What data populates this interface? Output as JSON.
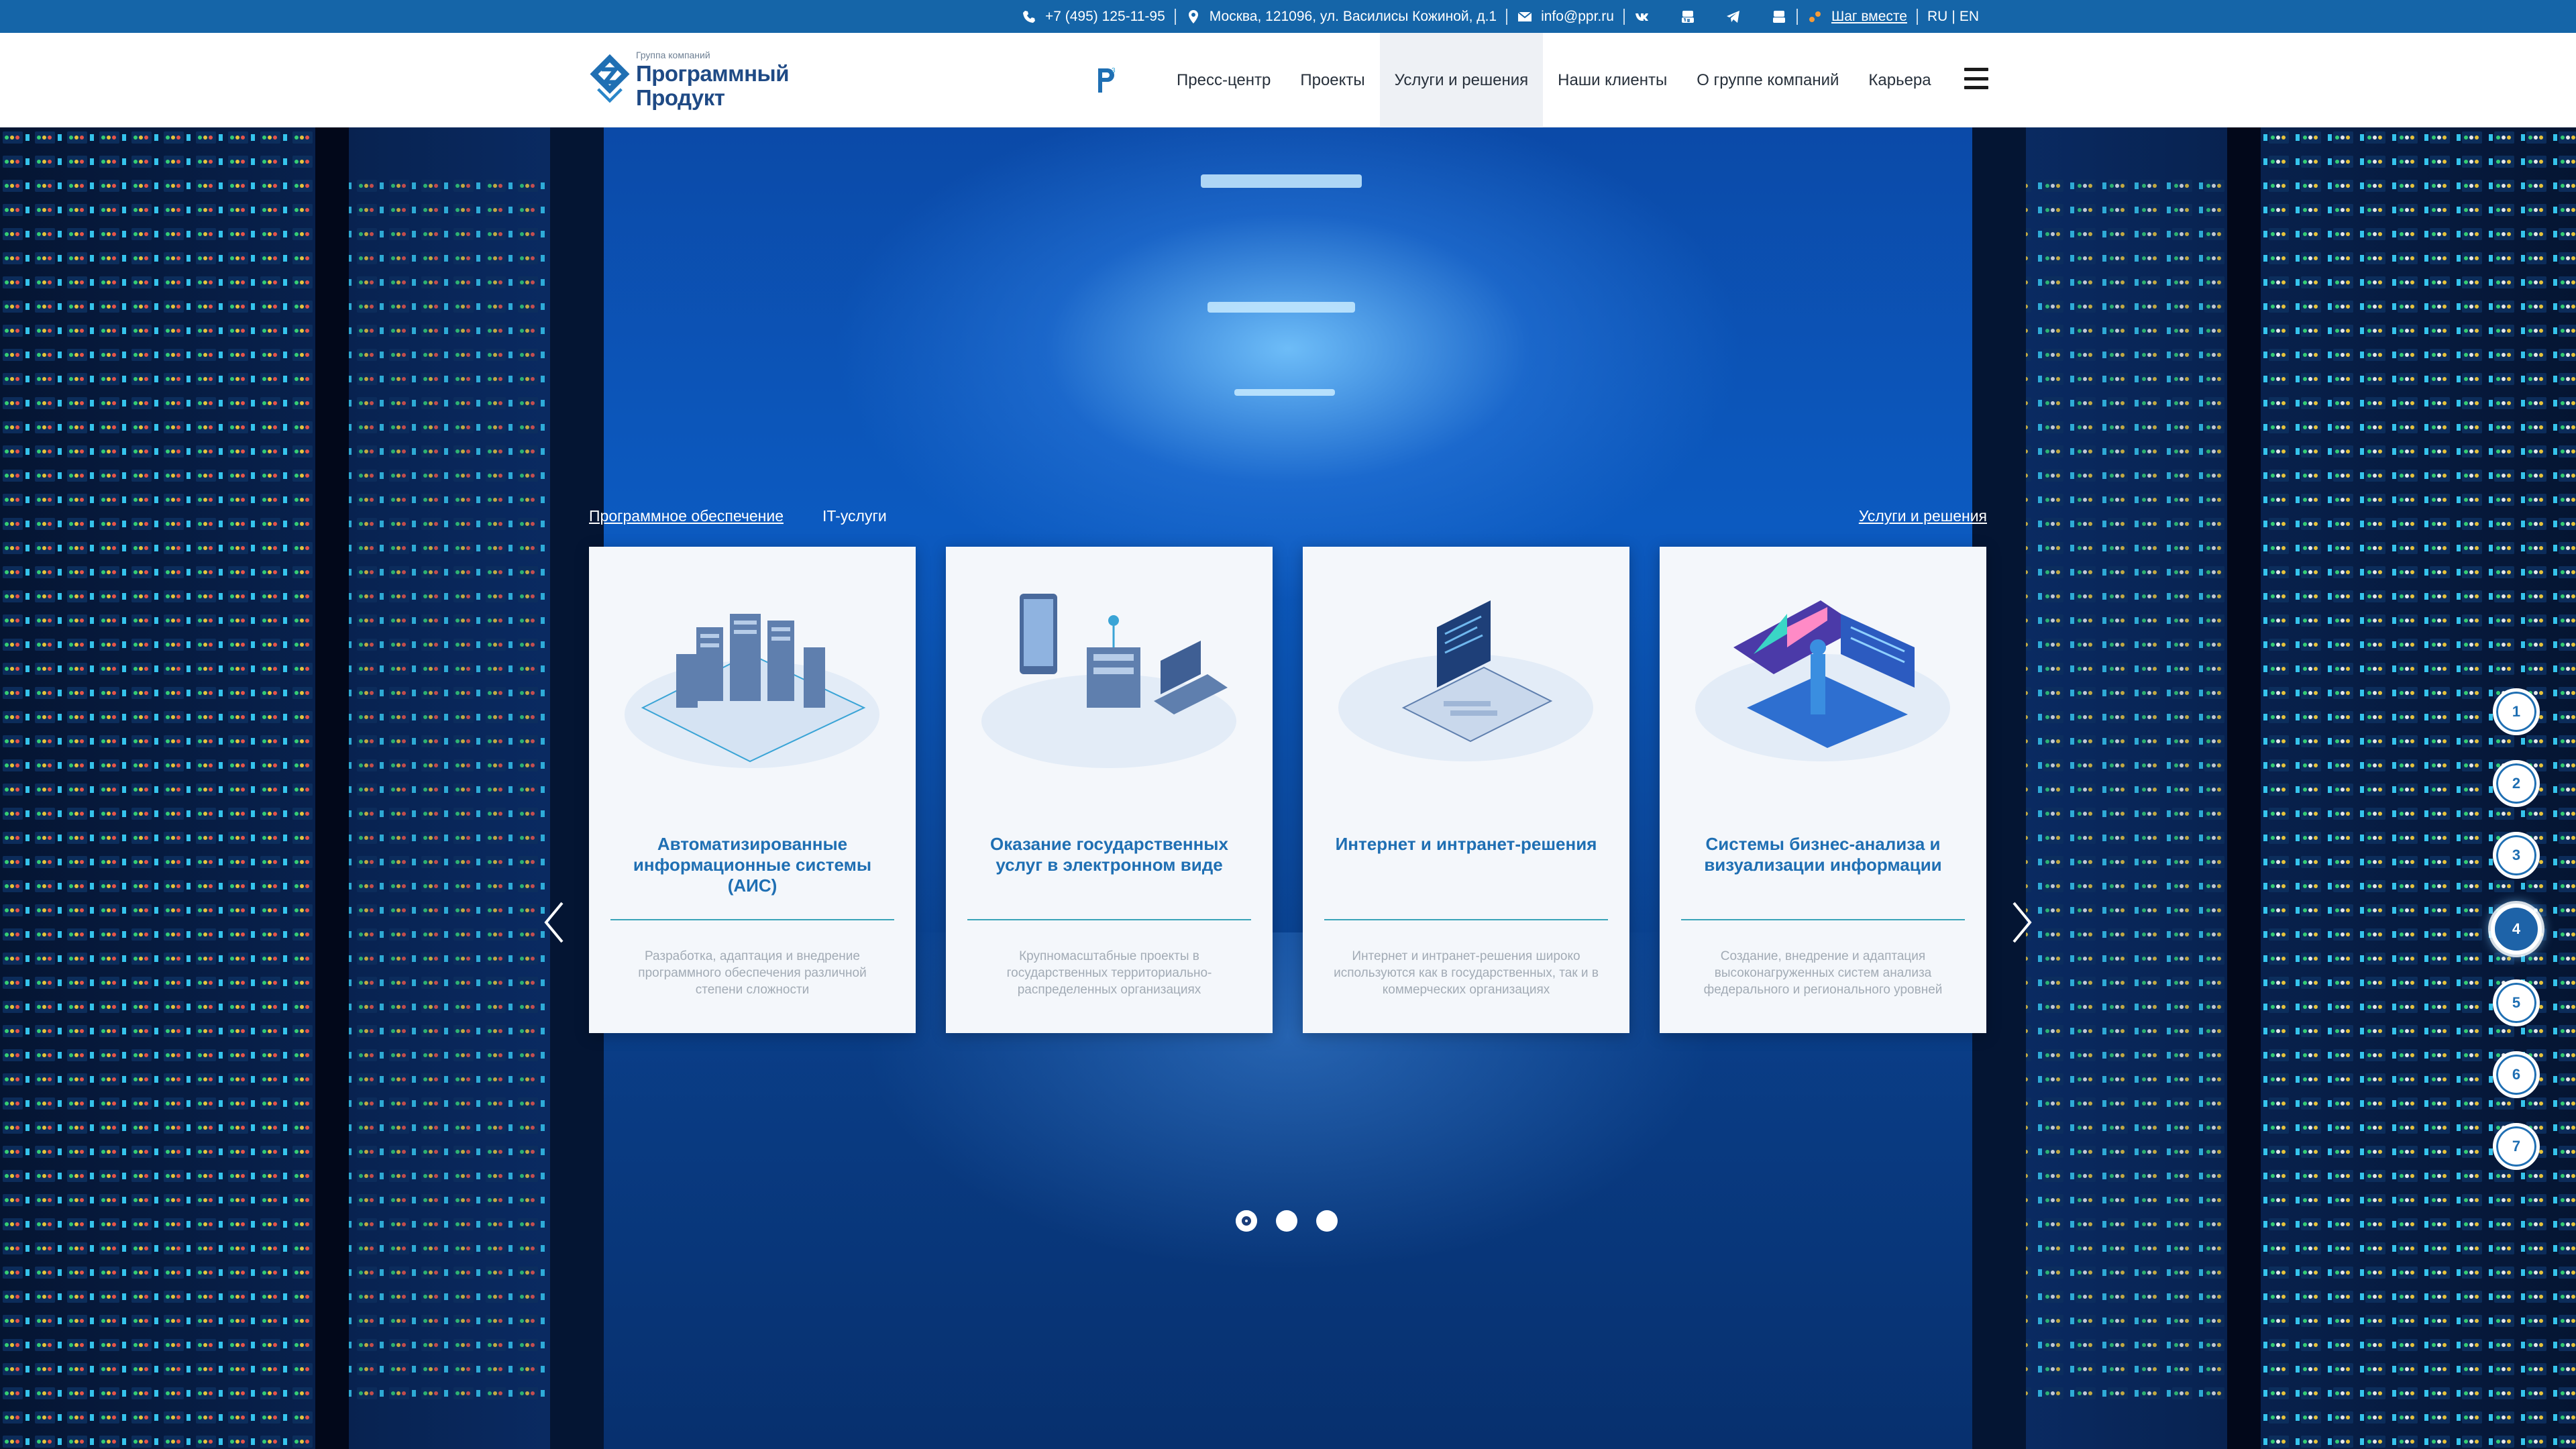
{
  "topbar": {
    "phone": "+7 (495) 125-11-95",
    "address": "Москва, 121096, ул. Василисы Кожиной, д.1",
    "email": "info@ppr.ru",
    "social": [
      "vk-icon",
      "youtube-icon",
      "telegram-icon",
      "video-icon"
    ],
    "together_link": "Шаг вместе",
    "lang_ru": "RU",
    "lang_sep": "|",
    "lang_en": "EN",
    "bg_color": "#1565a8"
  },
  "logo": {
    "small": "Группа компаний",
    "line1": "Программный",
    "line2": "Продукт"
  },
  "nav": {
    "items": [
      {
        "label": "Пресс-центр"
      },
      {
        "label": "Проекты"
      },
      {
        "label": "Услуги и решения",
        "active": true
      },
      {
        "label": "Наши клиенты"
      },
      {
        "label": "О группе компаний"
      },
      {
        "label": "Карьера"
      }
    ]
  },
  "hero": {
    "tabs": [
      {
        "label": "Программное обеспечение"
      },
      {
        "label": "IT-услуги"
      }
    ],
    "services_link": "Услуги и решения",
    "cards": [
      {
        "title": "Автоматизированные информационные системы (АИС)",
        "desc": "Разработка, адаптация и внедрение программного обеспечения различной степени сложности",
        "icon": "servers-illustration"
      },
      {
        "title": "Оказание государственных услуг в электронном виде",
        "desc": "Крупномасштабные проекты в государственных территориально-распределенных организациях",
        "icon": "devices-illustration"
      },
      {
        "title": "Интернет и интранет-решения",
        "desc": "Интернет и интранет-решения широко используются как в государственных, так и в коммерческих организациях",
        "icon": "laptop-illustration"
      },
      {
        "title": "Системы бизнес-анализа и визуализации информации",
        "desc": "Создание, внедрение и адаптация высоконагруженных систем анализа федерального и регионального уровней",
        "icon": "analytics-illustration"
      }
    ],
    "carousel_dots": 3,
    "active_dot": 1,
    "pager": [
      "1",
      "2",
      "3",
      "4",
      "5",
      "6",
      "7"
    ],
    "active_page": "4",
    "accent_color": "#1f6fb3",
    "rule_color": "#3aa4b8"
  }
}
